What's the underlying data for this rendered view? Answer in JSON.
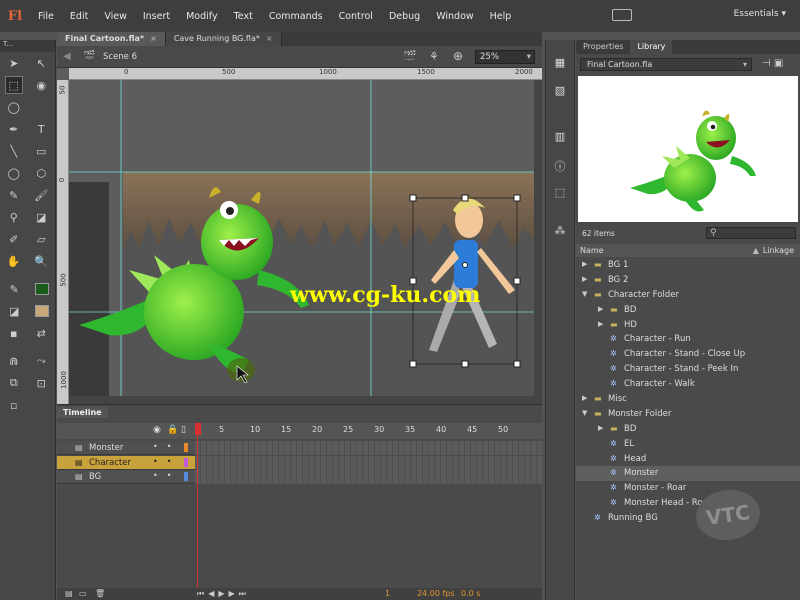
{
  "app": {
    "logo": "Fl",
    "workspace": "Essentials ▾"
  },
  "menu": [
    "File",
    "Edit",
    "View",
    "Insert",
    "Modify",
    "Text",
    "Commands",
    "Control",
    "Debug",
    "Window",
    "Help"
  ],
  "tools_header": "T...",
  "doc_tabs": [
    {
      "label": "Final Cartoon.fla*",
      "active": true
    },
    {
      "label": "Cave Running BG.fla*",
      "active": false
    }
  ],
  "editbar": {
    "scene": "Scene 6",
    "zoom": "25%"
  },
  "rulers": {
    "top": [
      "0",
      "500",
      "1000",
      "1500",
      "2000"
    ],
    "left": [
      "50",
      "0",
      "500",
      "1000"
    ]
  },
  "watermark": "www.cg-ku.com",
  "timeline": {
    "tab": "Timeline",
    "frame_numbers": [
      "1",
      "5",
      "10",
      "15",
      "20",
      "25",
      "30",
      "35",
      "40",
      "45",
      "50"
    ],
    "layers": [
      {
        "name": "Monster",
        "color": "#e88a2a",
        "selected": false
      },
      {
        "name": "Character",
        "color": "#c45ad8",
        "selected": true
      },
      {
        "name": "BG",
        "color": "#5a8ae0",
        "selected": false
      }
    ],
    "footer": {
      "frame": "1",
      "fps": "24.00 fps",
      "time": "0.0 s"
    }
  },
  "library": {
    "tabs": [
      "Properties",
      "Library"
    ],
    "document": "Final Cartoon.fla",
    "items_count": "62 items",
    "col_name": "Name",
    "col_linkage": "Linkage",
    "items": [
      {
        "label": "BG 1",
        "level": 0,
        "type": "folder",
        "state": "closed"
      },
      {
        "label": "BG 2",
        "level": 0,
        "type": "folder",
        "state": "closed"
      },
      {
        "label": "Character Folder",
        "level": 0,
        "type": "folder",
        "state": "open"
      },
      {
        "label": "BD",
        "level": 1,
        "type": "folder",
        "state": "closed"
      },
      {
        "label": "HD",
        "level": 1,
        "type": "folder",
        "state": "closed"
      },
      {
        "label": "Character - Run",
        "level": 1,
        "type": "symbol"
      },
      {
        "label": "Character - Stand - Close Up",
        "level": 1,
        "type": "symbol"
      },
      {
        "label": "Character - Stand - Peek In",
        "level": 1,
        "type": "symbol"
      },
      {
        "label": "Character - Walk",
        "level": 1,
        "type": "symbol"
      },
      {
        "label": "Misc",
        "level": 0,
        "type": "folder",
        "state": "closed"
      },
      {
        "label": "Monster Folder",
        "level": 0,
        "type": "folder",
        "state": "open"
      },
      {
        "label": "BD",
        "level": 1,
        "type": "folder",
        "state": "closed"
      },
      {
        "label": "EL",
        "level": 1,
        "type": "symbol"
      },
      {
        "label": "Head",
        "level": 1,
        "type": "symbol"
      },
      {
        "label": "Monster",
        "level": 1,
        "type": "symbol",
        "selected": true
      },
      {
        "label": "Monster - Roar",
        "level": 1,
        "type": "symbol"
      },
      {
        "label": "Monster Head - Roar",
        "level": 1,
        "type": "symbol"
      },
      {
        "label": "Running BG",
        "level": 0,
        "type": "symbol"
      }
    ],
    "vtc_logo": "VTC"
  },
  "colors": {
    "stroke": "#1a5a1a",
    "fill": "#c8a87a",
    "accent": "#e2663a"
  }
}
